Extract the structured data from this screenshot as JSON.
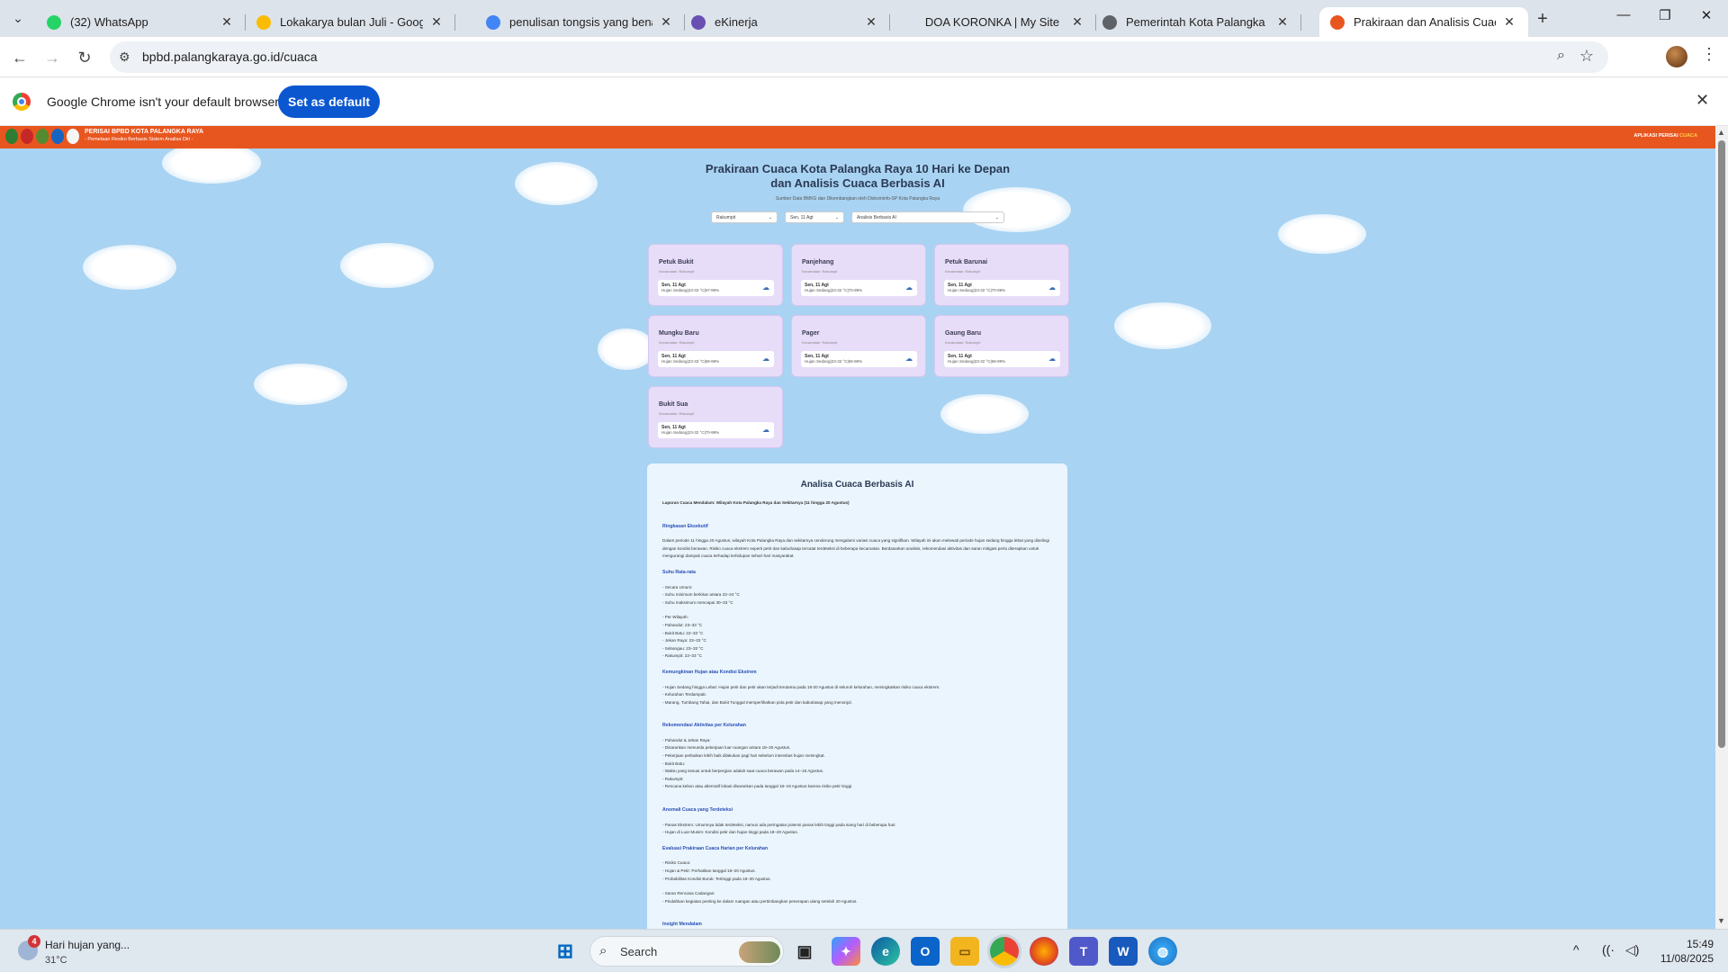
{
  "browser": {
    "tabs": [
      {
        "title": "(32) WhatsApp",
        "favicon": "whatsapp-icon",
        "color": "#25d366"
      },
      {
        "title": "Lokakarya bulan Juli - Google D",
        "favicon": "google-drive-icon",
        "color": "#fbbc05"
      },
      {
        "title": "penulisan tongsis yang benar -",
        "favicon": "google-icon",
        "color": "#4285f4"
      },
      {
        "title": "eKinerja",
        "favicon": "ekinerja-icon",
        "color": "#6a4fb3"
      },
      {
        "title": "DOA KORONKA | My Site",
        "favicon": "",
        "color": ""
      },
      {
        "title": "Pemerintah Kota Palangka Raya",
        "favicon": "globe-icon",
        "color": "#5f6368"
      },
      {
        "title": "Prakiraan dan Analisis Cuaca Ko",
        "favicon": "bpbd-icon",
        "color": "#e8561f",
        "active": true
      }
    ],
    "url": "bpbd.palangkaraya.go.id/cuaca"
  },
  "infobar": {
    "message": "Google Chrome isn't your default browser",
    "button": "Set as default"
  },
  "site": {
    "brand": "PERISAI BPBD KOTA PALANGKA RAYA",
    "brand_sub": "- Pemetaan Resiko Berbasis Sistem Analisa Diri -",
    "nav_apps": "APLIKASI PERISAI",
    "nav_cuaca": "CUACA",
    "title_line1": "Prakiraan Cuaca Kota Palangka Raya 10 Hari ke Depan",
    "title_line2": "dan Analisis Cuaca Berbasis AI",
    "source": "Sumber Data BMKG dan Dikembangkan oleh Diskominfo-SP Kota Palangka Raya",
    "filters": {
      "kecamatan": "Rakumpit",
      "tanggal": "Sen, 11 Agt",
      "mode": "Analisis Berbasis AI"
    }
  },
  "cards": [
    {
      "name": "Petuk Bukit",
      "kec": "Kecamatan: Rakumpit",
      "date": "Sen, 11 Agt",
      "weather": "Hujan Sedang|23-33 °C|67-99%"
    },
    {
      "name": "Panjehang",
      "kec": "Kecamatan: Rakumpit",
      "date": "Sen, 11 Agt",
      "weather": "Hujan Sedang|23-32 °C|70-99%"
    },
    {
      "name": "Petuk Barunai",
      "kec": "Kecamatan: Rakumpit",
      "date": "Sen, 11 Agt",
      "weather": "Hujan Sedang|23-32 °C|70-99%"
    },
    {
      "name": "Mungku Baru",
      "kec": "Kecamatan: Rakumpit",
      "date": "Sen, 11 Agt",
      "weather": "Hujan Sedang|23-33 °C|69-99%"
    },
    {
      "name": "Pager",
      "kec": "Kecamatan: Rakumpit",
      "date": "Sen, 11 Agt",
      "weather": "Hujan Sedang|23-32 °C|69-99%"
    },
    {
      "name": "Gaung Baru",
      "kec": "Kecamatan: Rakumpit",
      "date": "Sen, 11 Agt",
      "weather": "Hujan Sedang|23-32 °C|69-99%"
    },
    {
      "name": "Bukit Sua",
      "kec": "Kecamatan: Rakumpit",
      "date": "Sen, 11 Agt",
      "weather": "Hujan Sedang|23-32 °C|70-99%"
    }
  ],
  "analysis": {
    "title": "Analisa Cuaca Berbasis AI",
    "report_title": "Laporan Cuaca Mendalam: Wilayah Kota Palangka Raya dan Sekitarnya (11 hingga 20 Agustus)",
    "h_ringkasan": "Ringkasan Eksekutif",
    "ringkasan": "Dalam periode 11 hingga 20 Agustus, wilayah Kota Palangka Raya dan sekitarnya cenderung mengalami variasi cuaca yang signifikan. Wilayah ini akan melewati periode hujan sedang hingga lebat yang diselingi dengan kondisi berawan. Risiko cuaca ekstrem seperti petir dan kabut/asap tercatat terdeteksi di beberapa kecamatan. Berdasarkan analisis, rekomendasi aktivitas dan saran mitigasi perlu diterapkan untuk mengurangi dampak cuaca terhadap kehidupan sehari-hari masyarakat.",
    "h_suhu": "Suhu Rata-rata",
    "suhu_umum": "- Secara Umum:",
    "suhu_min": "- Suhu minimum berkisar antara 22–24 °C",
    "suhu_max": "- Suhu maksimum mencapai 30–33 °C",
    "per_wilayah": "- Per Wilayah:",
    "wilayah": [
      "- Pahandut: 23–33 °C",
      "- Bukit Batu: 22–33 °C",
      "- Jekan Raya: 23–33 °C",
      "- Sebangau: 23–33 °C",
      "- Rakumpit: 22–33 °C"
    ],
    "h_hujan": "Kemungkinan Hujan atau Kondisi Ekstrem",
    "hujan1": "- Hujan Sedang hingga Lebat: Hujan petir dan petir akan terjadi terutama pada 18-20 Agustus di seluruh kelurahan, meningkatkan risiko cuaca ekstrem.",
    "hujan2": "- Kelurahan Terdampak:",
    "hujan3": "- Marang, Tumbang Tahai, dan Bukit Tunggal memperlihatkan pola petir dan kabut/asap yang menonjol.",
    "h_rekom": "Rekomendasi Aktivitas per Kelurahan",
    "rekom": [
      "- Pahandut & Jekan Raya:",
      "- Disarankan menunda pekerjaan luar ruangan antara 18–20 Agustus.",
      "- Pekerjaan perbaikan lebih baik dilakukan pagi hari sebelum intensitas hujan meningkat.",
      "- Bukit Batu:",
      "- Waktu yang sesuai untuk berpergian adalah saat cuaca berawan pada 14–15 Agustus.",
      "- Rakumpit:",
      "- Rencana kebun atau alternatif lokasi disarankan pada tanggal 18–19 Agustus karena risiko petir tinggi."
    ],
    "h_anomali": "Anomali Cuaca yang Terdeteksi",
    "anomali": [
      "- Panas Ekstrem: Umumnya tidak terdeteksi, namun ada peringatan potensi panas lebih tinggi pada siang hari di beberapa hari.",
      "- Hujan di Luar Musim: Kondisi petir dan hujan tinggi pada 18–20 Agustus."
    ],
    "h_evaluasi": "Evaluasi Prakiraan Cuaca Harian per Kelurahan",
    "evaluasi": [
      "- Risiko Cuaca:",
      "- Hujan & Petir: Perhatikan tanggal 18–20 Agustus.",
      "- Probabilitas Kondisi Buruk: Tertinggi pada 18–20 Agustus.",
      "",
      "- Saran Rencana Cadangan:",
      "- Pindahkan kegiatan penting ke dalam ruangan atau pertimbangkan penerapan ulang setelah 20 Agustus."
    ],
    "h_insight": "Insight Mendalam"
  },
  "taskbar": {
    "weather_text": "Hari hujan yang...",
    "temp": "31°C",
    "badge": "4",
    "search": "Search",
    "time": "15:49",
    "date": "11/08/2025"
  }
}
